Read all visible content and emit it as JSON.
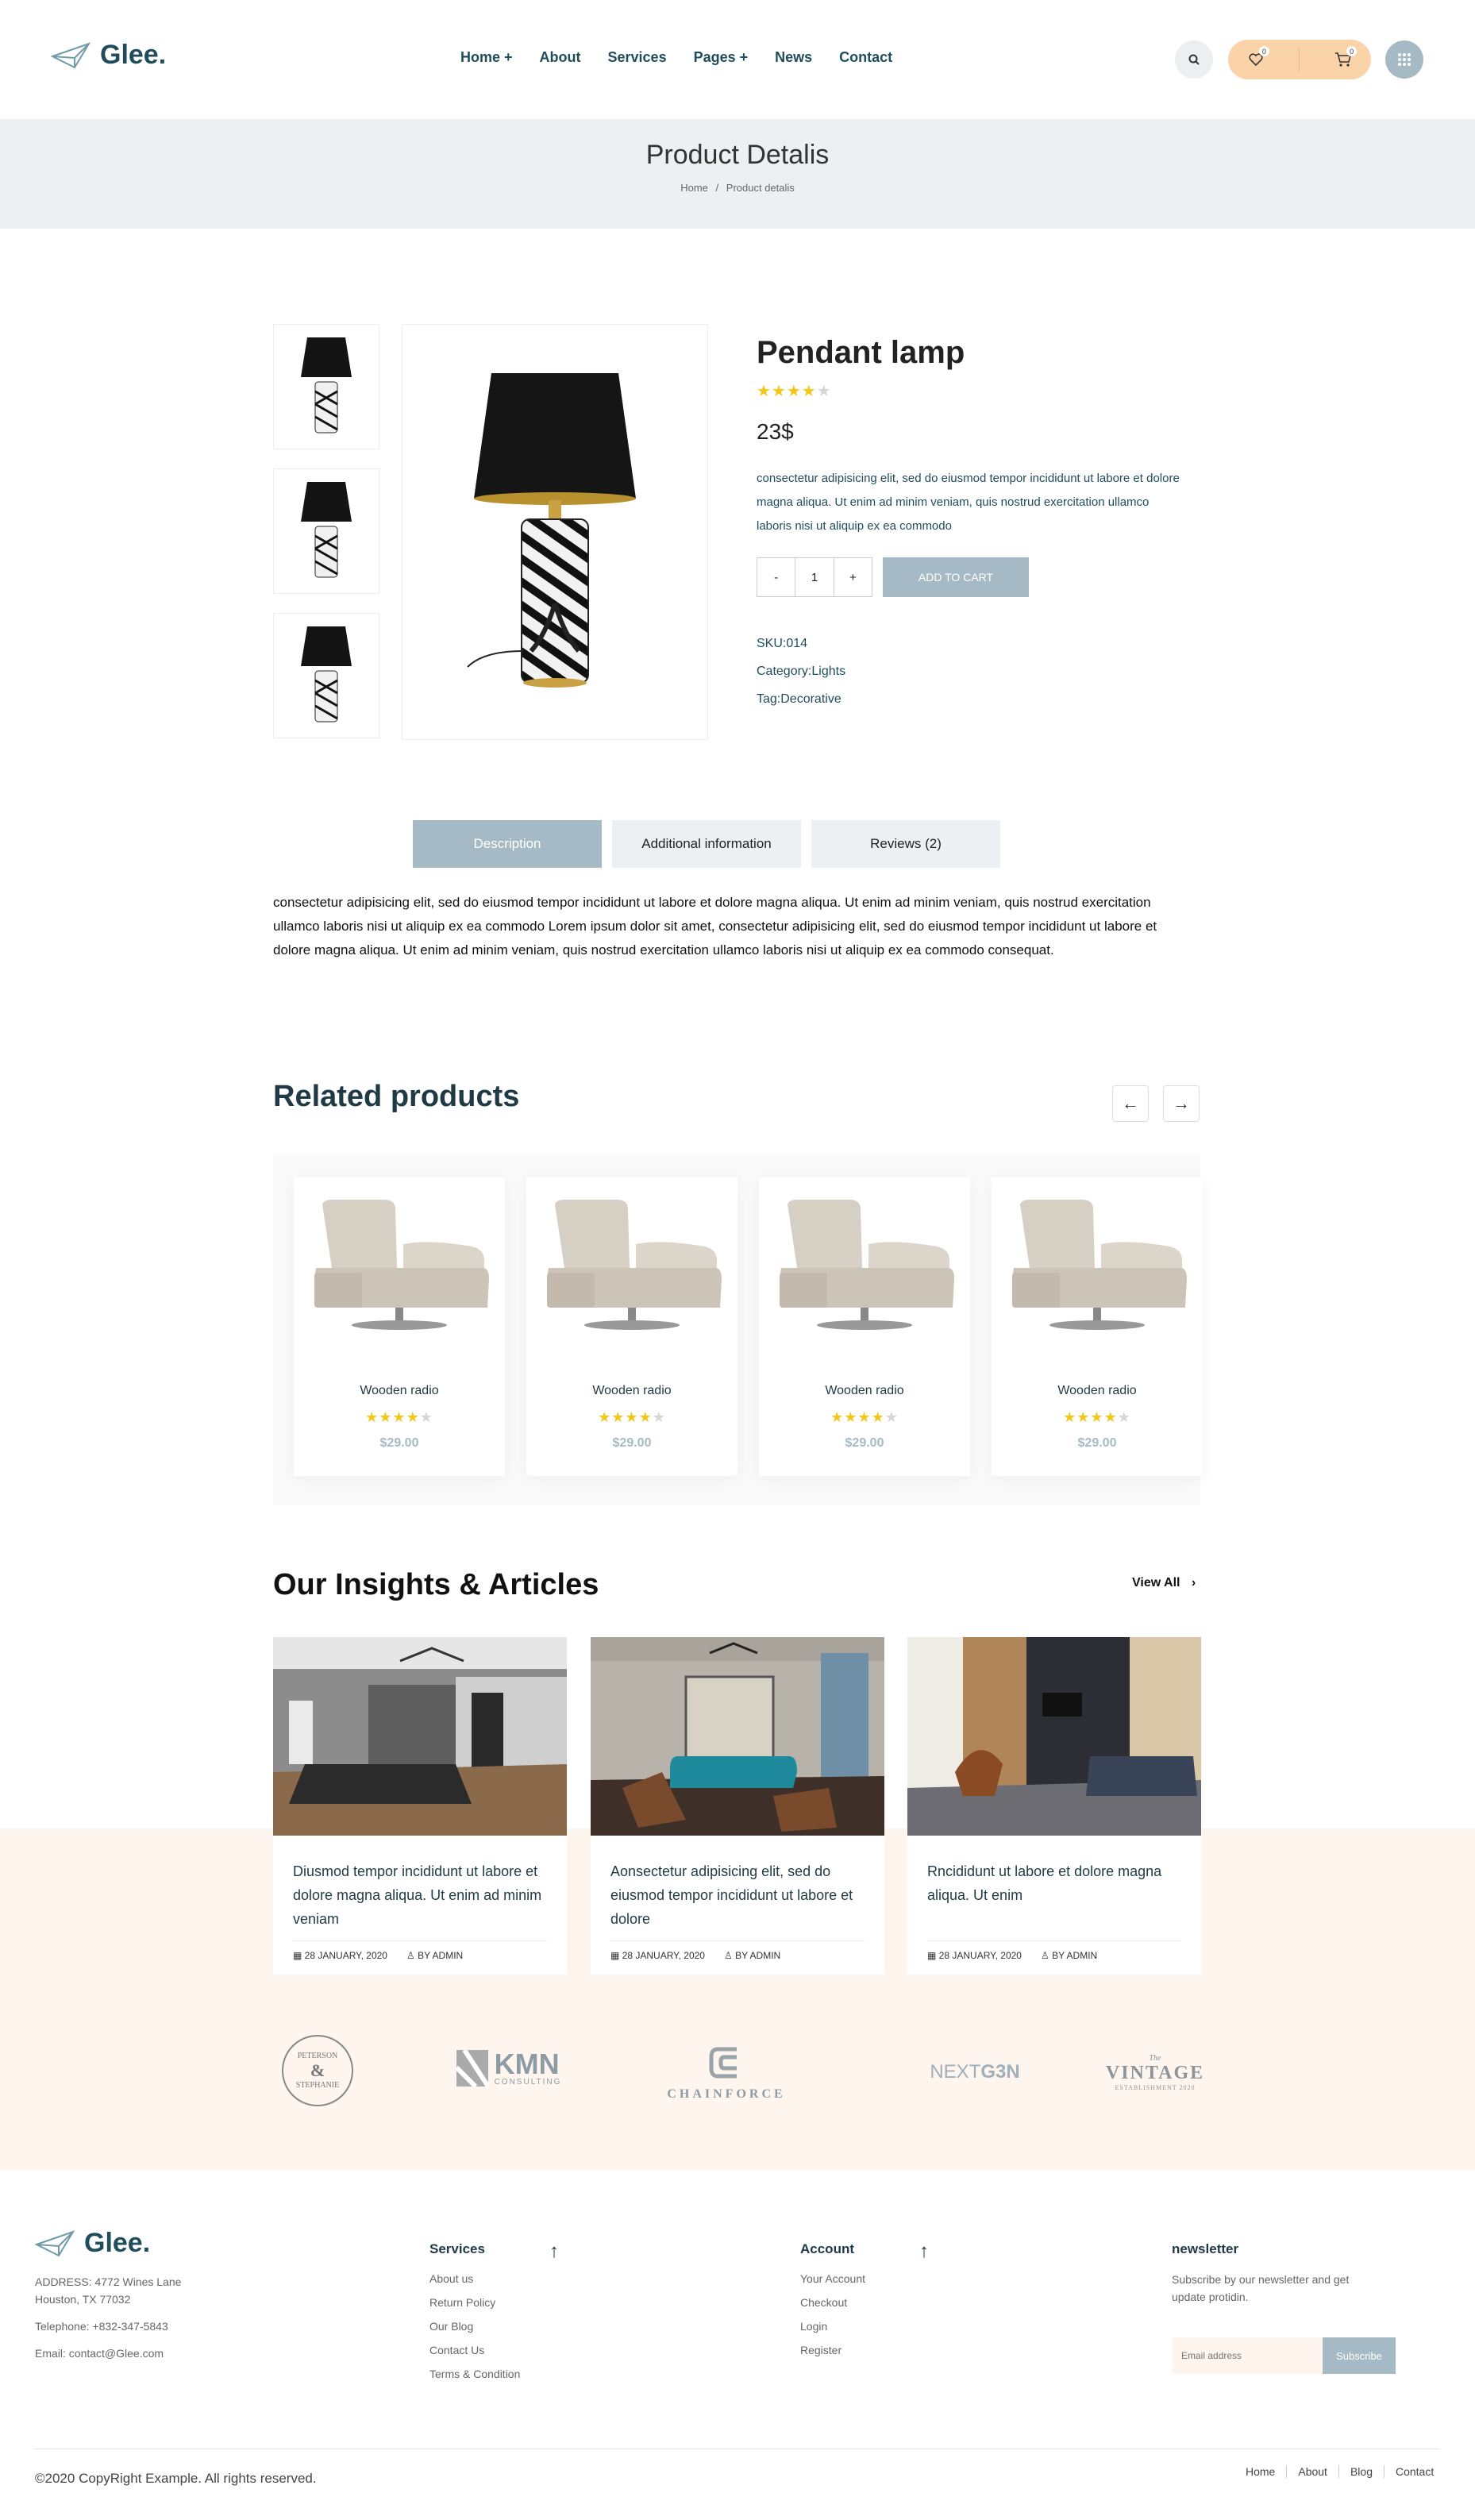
{
  "header": {
    "logo": "Glee.",
    "nav": [
      "Home +",
      "About",
      "Services",
      "Pages +",
      "News",
      "Contact"
    ],
    "wishlist_count": "0",
    "cart_count": "0",
    "icons": [
      "search-icon",
      "heart-icon",
      "cart-icon",
      "grid-menu-icon"
    ]
  },
  "banner": {
    "title": "Product Detalis",
    "crumb_home": "Home",
    "crumb_sep": "/",
    "crumb_current": "Product detalis"
  },
  "product": {
    "title": "Pendant lamp",
    "rating": 4,
    "rating_max": 5,
    "price": "23$",
    "description": "consectetur adipisicing elit, sed do eiusmod tempor incididunt ut labore et dolore magna aliqua. Ut enim ad minim veniam, quis nostrud exercitation ullamco laboris nisi ut aliquip ex ea commodo",
    "qty_minus": "-",
    "qty_value": "1",
    "qty_plus": "+",
    "add_to_cart": "ADD TO CART",
    "sku": "SKU:014",
    "category": "Category:Lights",
    "tag": "Tag:Decorative"
  },
  "tabs": {
    "items": [
      "Description",
      "Additional information",
      "Reviews (2)"
    ],
    "active": "Description",
    "content": "consectetur adipisicing elit, sed do eiusmod tempor incididunt ut labore et dolore magna aliqua. Ut enim ad minim veniam, quis nostrud exercitation ullamco laboris nisi ut aliquip ex ea commodo Lorem ipsum dolor sit amet, consectetur adipisicing elit, sed do eiusmod tempor incididunt ut labore et dolore magna aliqua. Ut enim ad minim veniam, quis nostrud exercitation ullamco laboris nisi ut aliquip ex ea commodo consequat."
  },
  "related": {
    "title": "Related products",
    "prev": "←",
    "next": "→",
    "items": [
      {
        "name": "Wooden radio",
        "price": "$29.00",
        "rating": 4
      },
      {
        "name": "Wooden radio",
        "price": "$29.00",
        "rating": 4
      },
      {
        "name": "Wooden radio",
        "price": "$29.00",
        "rating": 4
      },
      {
        "name": "Wooden radio",
        "price": "$29.00",
        "rating": 4
      }
    ]
  },
  "insights": {
    "title": "Our Insights & Articles",
    "view_all": "View All",
    "view_all_arrow": "›",
    "articles": [
      {
        "title": "Diusmod tempor incididunt ut labore et dolore magna aliqua. Ut enim ad minim veniam",
        "date": "28 JANUARY, 2020",
        "author": "BY ADMIN"
      },
      {
        "title": "Aonsectetur adipisicing elit, sed do eiusmod tempor incididunt ut labore et dolore",
        "date": "28 JANUARY, 2020",
        "author": "BY ADMIN"
      },
      {
        "title": "Rncididunt ut labore et dolore magna aliqua. Ut enim",
        "date": "28 JANUARY, 2020",
        "author": "BY ADMIN"
      }
    ]
  },
  "brands": {
    "peterson_top": "PETERSON",
    "peterson_mid": "&",
    "peterson_bottom": "STEPHANIE",
    "kmn": "KMN",
    "kmn_sub": "CONSULTING",
    "chainforce": "CHAINFORCE",
    "nextgen_a": "NEXT",
    "nextgen_b": "G3N",
    "vintage_top": "The",
    "vintage": "VINTAGE",
    "vintage_sub": "ESTABLISHMENT 2020"
  },
  "footer": {
    "logo": "Glee.",
    "address_line1": "ADDRESS: 4772 Wines Lane",
    "address_line2": "Houston, TX 77032",
    "telephone": "Telephone: +832-347-5843",
    "email": "Email: contact@Glee.com",
    "services_title": "Services",
    "services_links": [
      "About us",
      "Return Policy",
      "Our Blog",
      "Contact Us",
      "Terms & Condition"
    ],
    "account_title": "Account",
    "account_links": [
      "Your Account",
      "Checkout",
      "Login",
      "Register"
    ],
    "scroll_arrow": "↑",
    "newsletter_title": "newsletter",
    "newsletter_text": "Subscribe by our newsletter and get update protidin.",
    "email_placeholder": "Email address",
    "subscribe": "Subscribe",
    "copyright": "©2020 CopyRight Example. All rights reserved.",
    "bottom_links": [
      "Home",
      "About",
      "Blog",
      "Contact"
    ]
  },
  "colors": {
    "brand_dark": "#1f4d5c",
    "accent_blue_gray": "#a5bac5",
    "accent_peach": "#fbd3a8",
    "peach_bg": "#fdf5ee",
    "banner_bg": "#edf0f2",
    "star": "#f5c518"
  }
}
